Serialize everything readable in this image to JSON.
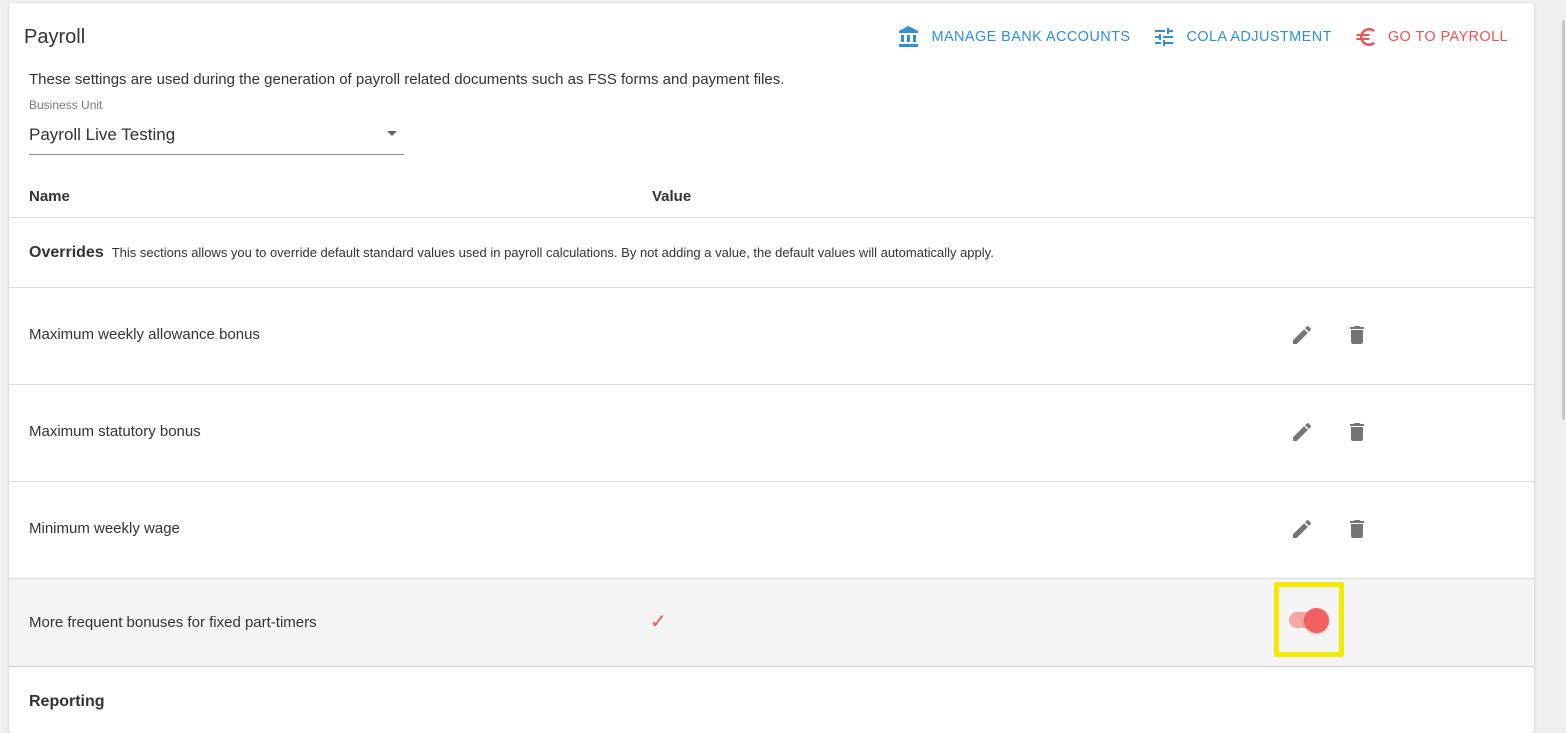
{
  "page": {
    "title": "Payroll",
    "description": "These settings are used during the generation of payroll related documents such as FSS forms and payment files."
  },
  "actions": [
    {
      "label": "MANAGE BANK ACCOUNTS",
      "icon": "bank-icon",
      "color": "#2f8fd8"
    },
    {
      "label": "COLA ADJUSTMENT",
      "icon": "tune-icon",
      "color": "#2f8fd8"
    },
    {
      "label": "GO TO PAYROLL",
      "icon": "euro-icon",
      "color": "#ef5350"
    }
  ],
  "business_unit": {
    "label": "Business Unit",
    "value": "Payroll Live Testing"
  },
  "table": {
    "headers": {
      "name": "Name",
      "value": "Value"
    }
  },
  "overrides": {
    "title": "Overrides",
    "description": "This sections allows you to override default standard values used in payroll calculations. By not adding a value, the default values will automatically apply.",
    "rows": [
      {
        "name": "Maximum weekly allowance bonus",
        "value": ""
      },
      {
        "name": "Maximum statutory bonus",
        "value": ""
      },
      {
        "name": "Minimum weekly wage",
        "value": ""
      }
    ],
    "toggle_row": {
      "name": "More frequent bonuses for fixed part-timers",
      "value": "✓",
      "toggle_on": true
    }
  },
  "reporting": {
    "title": "Reporting"
  },
  "colors": {
    "accent_blue": "#2f8fd8",
    "accent_red": "#ef5350",
    "highlight_yellow": "#f2eb00",
    "icon_grey": "#757575"
  }
}
